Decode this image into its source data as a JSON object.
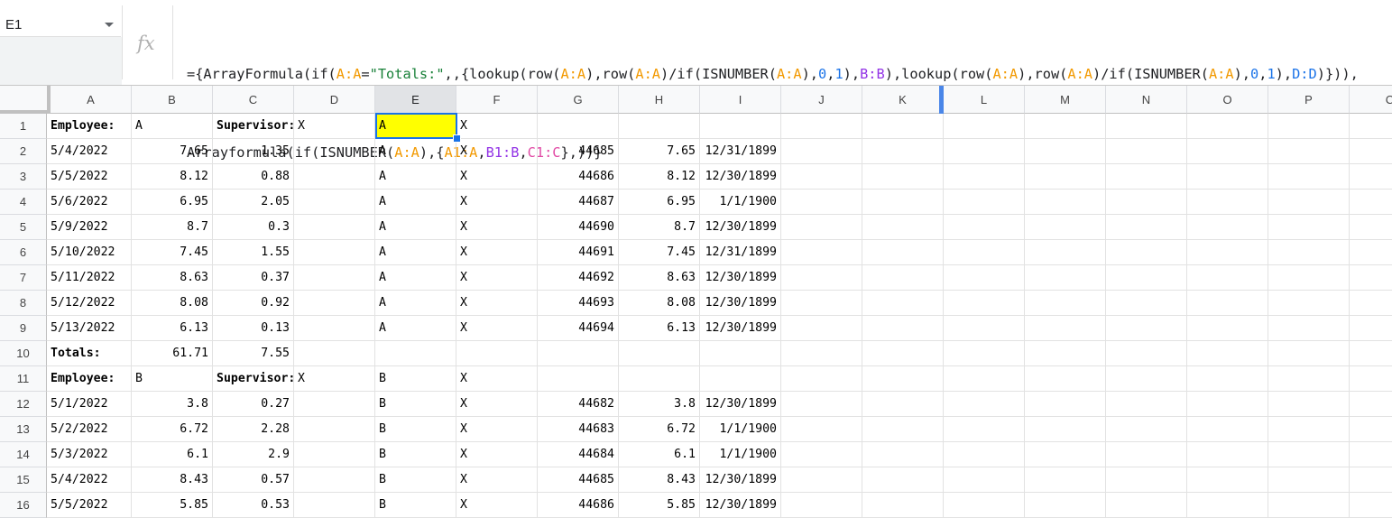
{
  "name_box": {
    "value": "E1"
  },
  "formula_bar": {
    "fx_label": "fx",
    "line1": [
      {
        "t": "={ArrayFormula(if(",
        "c": ""
      },
      {
        "t": "A:A",
        "c": "c-rA"
      },
      {
        "t": "=",
        "c": ""
      },
      {
        "t": "\"Totals:\"",
        "c": "c-str"
      },
      {
        "t": ",,{lookup(row(",
        "c": ""
      },
      {
        "t": "A:A",
        "c": "c-rA"
      },
      {
        "t": "),row(",
        "c": ""
      },
      {
        "t": "A:A",
        "c": "c-rA"
      },
      {
        "t": ")/if(ISNUMBER(",
        "c": ""
      },
      {
        "t": "A:A",
        "c": "c-rA"
      },
      {
        "t": "),",
        "c": ""
      },
      {
        "t": "0",
        "c": "c-num"
      },
      {
        "t": ",",
        "c": ""
      },
      {
        "t": "1",
        "c": "c-num"
      },
      {
        "t": "),",
        "c": ""
      },
      {
        "t": "B:B",
        "c": "c-rB"
      },
      {
        "t": "),lookup(row(",
        "c": ""
      },
      {
        "t": "A:A",
        "c": "c-rA"
      },
      {
        "t": "),row(",
        "c": ""
      },
      {
        "t": "A:A",
        "c": "c-rA"
      },
      {
        "t": ")/if(ISNUMBER(",
        "c": ""
      },
      {
        "t": "A:A",
        "c": "c-rA"
      },
      {
        "t": "),",
        "c": ""
      },
      {
        "t": "0",
        "c": "c-num"
      },
      {
        "t": ",",
        "c": ""
      },
      {
        "t": "1",
        "c": "c-num"
      },
      {
        "t": "),",
        "c": ""
      },
      {
        "t": "D:D",
        "c": "c-rD"
      },
      {
        "t": ")})),",
        "c": ""
      }
    ],
    "line2": [
      {
        "t": "Arrayformula(if(ISNUMBER(",
        "c": ""
      },
      {
        "t": "A:A",
        "c": "c-rA"
      },
      {
        "t": "),{",
        "c": ""
      },
      {
        "t": "A1:A",
        "c": "c-rA"
      },
      {
        "t": ",",
        "c": ""
      },
      {
        "t": "B1:B",
        "c": "c-rB"
      },
      {
        "t": ",",
        "c": ""
      },
      {
        "t": "C1:C",
        "c": "c-rC"
      },
      {
        "t": "},))}",
        "c": ""
      }
    ]
  },
  "columns": [
    "A",
    "B",
    "C",
    "D",
    "E",
    "F",
    "G",
    "H",
    "I",
    "J",
    "K",
    "L",
    "M",
    "N",
    "O",
    "P",
    "C"
  ],
  "selected_column": "E",
  "selected_cell": {
    "row": 1,
    "col": "E"
  },
  "highlight_color": "#ffff00",
  "rows": [
    {
      "n": "1",
      "A": "Employee:",
      "B": "A",
      "C": "Supervisor:",
      "D": "X",
      "E": "A",
      "F": "X",
      "G": "",
      "H": "",
      "I": ""
    },
    {
      "n": "2",
      "A": "5/4/2022",
      "B": "7.65",
      "C": "1.35",
      "D": "",
      "E": "A",
      "F": "X",
      "G": "44685",
      "H": "7.65",
      "I": "12/31/1899"
    },
    {
      "n": "3",
      "A": "5/5/2022",
      "B": "8.12",
      "C": "0.88",
      "D": "",
      "E": "A",
      "F": "X",
      "G": "44686",
      "H": "8.12",
      "I": "12/30/1899"
    },
    {
      "n": "4",
      "A": "5/6/2022",
      "B": "6.95",
      "C": "2.05",
      "D": "",
      "E": "A",
      "F": "X",
      "G": "44687",
      "H": "6.95",
      "I": "1/1/1900"
    },
    {
      "n": "5",
      "A": "5/9/2022",
      "B": "8.7",
      "C": "0.3",
      "D": "",
      "E": "A",
      "F": "X",
      "G": "44690",
      "H": "8.7",
      "I": "12/30/1899"
    },
    {
      "n": "6",
      "A": "5/10/2022",
      "B": "7.45",
      "C": "1.55",
      "D": "",
      "E": "A",
      "F": "X",
      "G": "44691",
      "H": "7.45",
      "I": "12/31/1899"
    },
    {
      "n": "7",
      "A": "5/11/2022",
      "B": "8.63",
      "C": "0.37",
      "D": "",
      "E": "A",
      "F": "X",
      "G": "44692",
      "H": "8.63",
      "I": "12/30/1899"
    },
    {
      "n": "8",
      "A": "5/12/2022",
      "B": "8.08",
      "C": "0.92",
      "D": "",
      "E": "A",
      "F": "X",
      "G": "44693",
      "H": "8.08",
      "I": "12/30/1899"
    },
    {
      "n": "9",
      "A": "5/13/2022",
      "B": "6.13",
      "C": "0.13",
      "D": "",
      "E": "A",
      "F": "X",
      "G": "44694",
      "H": "6.13",
      "I": "12/30/1899"
    },
    {
      "n": "10",
      "A": "Totals:",
      "B": "61.71",
      "C": "7.55",
      "D": "",
      "E": "",
      "F": "",
      "G": "",
      "H": "",
      "I": ""
    },
    {
      "n": "11",
      "A": "Employee:",
      "B": "B",
      "C": "Supervisor:",
      "D": "X",
      "E": "B",
      "F": "X",
      "G": "",
      "H": "",
      "I": ""
    },
    {
      "n": "12",
      "A": "5/1/2022",
      "B": "3.8",
      "C": "0.27",
      "D": "",
      "E": "B",
      "F": "X",
      "G": "44682",
      "H": "3.8",
      "I": "12/30/1899"
    },
    {
      "n": "13",
      "A": "5/2/2022",
      "B": "6.72",
      "C": "2.28",
      "D": "",
      "E": "B",
      "F": "X",
      "G": "44683",
      "H": "6.72",
      "I": "1/1/1900"
    },
    {
      "n": "14",
      "A": "5/3/2022",
      "B": "6.1",
      "C": "2.9",
      "D": "",
      "E": "B",
      "F": "X",
      "G": "44684",
      "H": "6.1",
      "I": "1/1/1900"
    },
    {
      "n": "15",
      "A": "5/4/2022",
      "B": "8.43",
      "C": "0.57",
      "D": "",
      "E": "B",
      "F": "X",
      "G": "44685",
      "H": "8.43",
      "I": "12/30/1899"
    },
    {
      "n": "16",
      "A": "5/5/2022",
      "B": "5.85",
      "C": "0.53",
      "D": "",
      "E": "B",
      "F": "X",
      "G": "44686",
      "H": "5.85",
      "I": "12/30/1899"
    }
  ]
}
